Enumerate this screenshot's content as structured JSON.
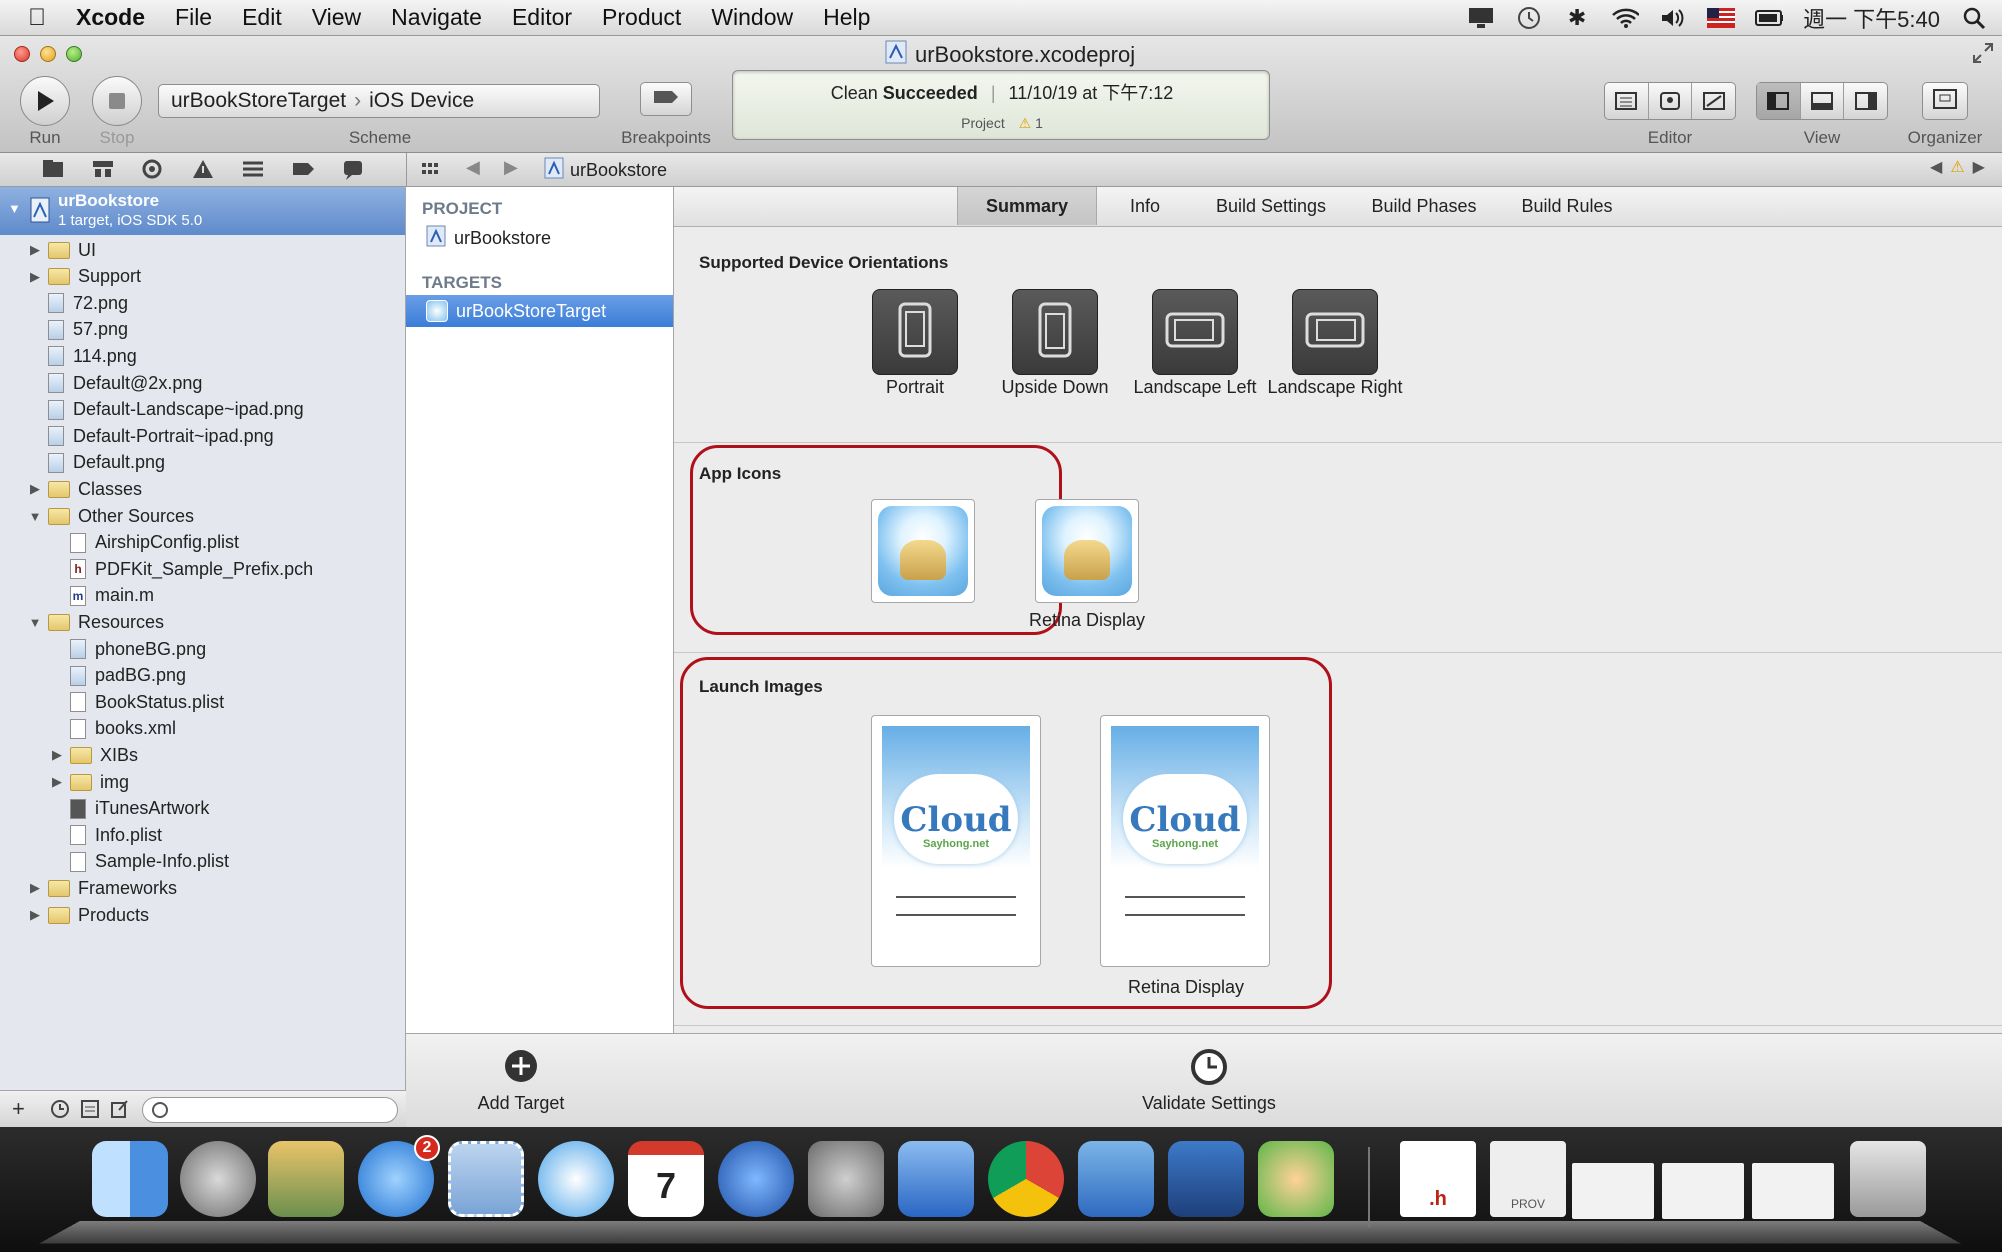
{
  "menubar": {
    "app": "Xcode",
    "items": [
      "File",
      "Edit",
      "View",
      "Navigate",
      "Editor",
      "Product",
      "Window",
      "Help"
    ],
    "clock": "週一 下午5:40"
  },
  "window": {
    "title": "urBookstore.xcodeproj"
  },
  "toolbar": {
    "run_label": "Run",
    "stop_label": "Stop",
    "scheme_target": "urBookStoreTarget",
    "scheme_device": "iOS Device",
    "scheme_label": "Scheme",
    "breakpoints_label": "Breakpoints",
    "status_main_prefix": "Clean",
    "status_main_bold": "Succeeded",
    "status_date": "11/10/19 at 下午7:12",
    "status_project": "Project",
    "status_warnings": "1",
    "editor_label": "Editor",
    "view_label": "View",
    "organizer_label": "Organizer"
  },
  "jumpbar": {
    "crumb": "urBookstore"
  },
  "navigator": {
    "root_name": "urBookstore",
    "root_sub": "1 target, iOS SDK 5.0",
    "items": [
      {
        "label": "UI",
        "type": "folder",
        "expand": "closed",
        "depth": 0
      },
      {
        "label": "Support",
        "type": "folder",
        "expand": "closed",
        "depth": 0
      },
      {
        "label": "72.png",
        "type": "image",
        "depth": 0
      },
      {
        "label": "57.png",
        "type": "image",
        "depth": 0
      },
      {
        "label": "114.png",
        "type": "image",
        "depth": 0
      },
      {
        "label": "Default@2x.png",
        "type": "image",
        "depth": 0
      },
      {
        "label": "Default-Landscape~ipad.png",
        "type": "image",
        "depth": 0
      },
      {
        "label": "Default-Portrait~ipad.png",
        "type": "image",
        "depth": 0
      },
      {
        "label": "Default.png",
        "type": "image",
        "depth": 0
      },
      {
        "label": "Classes",
        "type": "folder",
        "expand": "closed",
        "depth": 0
      },
      {
        "label": "Other Sources",
        "type": "folder",
        "expand": "open",
        "depth": 0
      },
      {
        "label": "AirshipConfig.plist",
        "type": "plist",
        "depth": 1
      },
      {
        "label": "PDFKit_Sample_Prefix.pch",
        "type": "h",
        "depth": 1
      },
      {
        "label": "main.m",
        "type": "m",
        "depth": 1
      },
      {
        "label": "Resources",
        "type": "folder",
        "expand": "open",
        "depth": 0
      },
      {
        "label": "phoneBG.png",
        "type": "image",
        "depth": 1
      },
      {
        "label": "padBG.png",
        "type": "image",
        "depth": 1
      },
      {
        "label": "BookStatus.plist",
        "type": "plist",
        "depth": 1
      },
      {
        "label": "books.xml",
        "type": "plist",
        "depth": 1
      },
      {
        "label": "XIBs",
        "type": "folder",
        "expand": "closed",
        "depth": 1
      },
      {
        "label": "img",
        "type": "folder",
        "expand": "closed",
        "depth": 1
      },
      {
        "label": "iTunesArtwork",
        "type": "dark",
        "depth": 1
      },
      {
        "label": "Info.plist",
        "type": "plist",
        "depth": 1
      },
      {
        "label": "Sample-Info.plist",
        "type": "plist",
        "depth": 1
      },
      {
        "label": "Frameworks",
        "type": "folder",
        "expand": "closed",
        "depth": 0
      },
      {
        "label": "Products",
        "type": "folder",
        "expand": "closed",
        "depth": 0
      }
    ]
  },
  "targets_pane": {
    "project_header": "PROJECT",
    "project_item": "urBookstore",
    "targets_header": "TARGETS",
    "target_item": "urBookStoreTarget"
  },
  "tabs": [
    "Summary",
    "Info",
    "Build Settings",
    "Build Phases",
    "Build Rules"
  ],
  "summary": {
    "orientations_title": "Supported Device Orientations",
    "orientations": [
      "Portrait",
      "Upside Down",
      "Landscape Left",
      "Landscape Right"
    ],
    "app_icons_title": "App Icons",
    "app_icons_retina": "Retina Display",
    "launch_title": "Launch Images",
    "launch_retina": "Retina Display",
    "launch_cloud": "Cloud",
    "launch_site": "Sayhong.net"
  },
  "bottom": {
    "add_target": "Add Target",
    "validate": "Validate Settings"
  },
  "dock": {
    "appstore_badge": "2",
    "calendar_day": "7",
    "doc_ext": ".h",
    "prov_label": "PROV"
  },
  "colors": {
    "selection": "#3b7dd8",
    "highlight_box": "#b0101a"
  }
}
